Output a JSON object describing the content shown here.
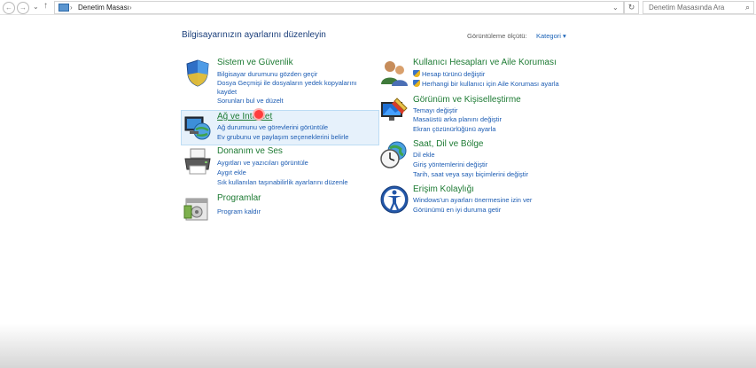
{
  "address_bar": {
    "path": "Denetim Masası",
    "search_placeholder": "Denetim Masasında Ara"
  },
  "header": {
    "title": "Bilgisayarınızın ayarlarını düzenleyin",
    "view_by_label": "Görüntüleme ölçütü:",
    "view_by_value": "Kategori"
  },
  "left_categories": [
    {
      "title": "Sistem ve Güvenlik",
      "icon": "shield-icon",
      "links": [
        "Bilgisayar durumunu gözden geçir",
        "Dosya Geçmişi ile dosyaların yedek kopyalarını",
        "kaydet",
        "Sorunları bul ve düzelt"
      ]
    },
    {
      "title": "Ağ ve Internet",
      "icon": "network-globe-icon",
      "links": [
        "Ağ durumunu ve görevlerini görüntüle",
        "Ev grubunu ve paylaşım seçeneklerini belirle"
      ]
    },
    {
      "title": "Donanım ve Ses",
      "icon": "printer-icon",
      "links": [
        "Aygıtları ve yazıcıları görüntüle",
        "Aygıt ekle",
        "Sık kullanılan taşınabilirlik ayarlarını düzenle"
      ]
    },
    {
      "title": "Programlar",
      "icon": "programs-icon",
      "links": [
        "Program kaldır"
      ]
    }
  ],
  "right_categories": [
    {
      "title": "Kullanıcı Hesapları ve Aile Koruması",
      "icon": "users-icon",
      "links": [
        "Hesap türünü değiştir",
        "Herhangi bir kullanıcı için Aile Koruması ayarla"
      ]
    },
    {
      "title": "Görünüm ve Kişiselleştirme",
      "icon": "display-brush-icon",
      "links": [
        "Temayı değiştir",
        "Masaüstü arka planını değiştir",
        "Ekran çözünürlüğünü ayarla"
      ]
    },
    {
      "title": "Saat, Dil ve Bölge",
      "icon": "clock-globe-icon",
      "links": [
        "Dil ekle",
        "Giriş yöntemlerini değiştir",
        "Tarih, saat veya sayı biçimlerini değiştir"
      ]
    },
    {
      "title": "Erişim Kolaylığı",
      "icon": "accessibility-icon",
      "links": [
        "Windows'un ayarları önermesine izin ver",
        "Görünümü en iyi duruma getir"
      ]
    }
  ]
}
